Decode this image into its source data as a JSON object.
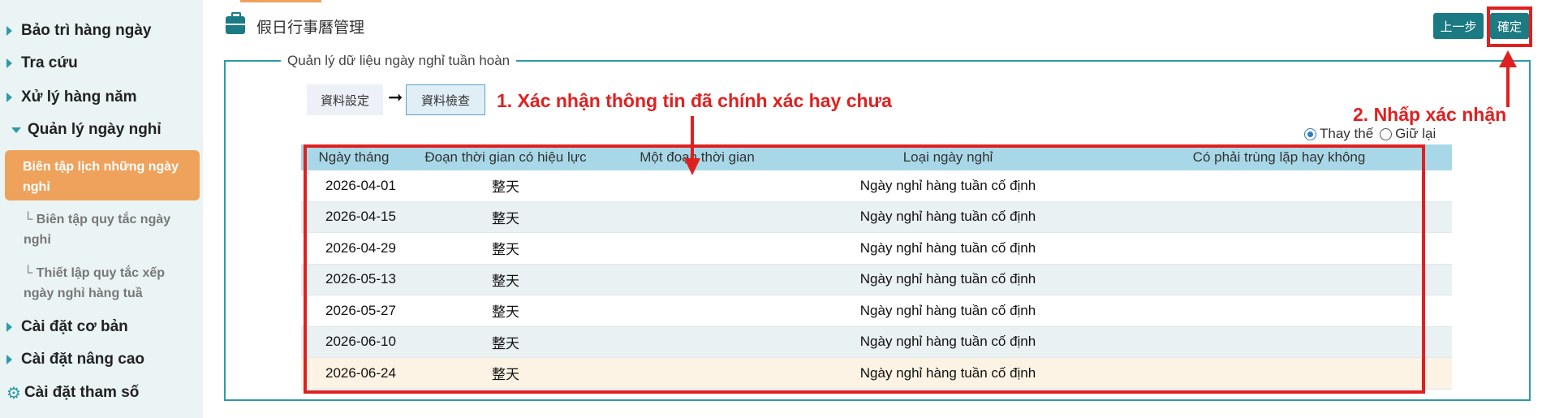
{
  "sidebar": {
    "items": [
      {
        "label": "Bảo trì hàng ngày"
      },
      {
        "label": "Tra cứu"
      },
      {
        "label": "Xử lý hàng năm"
      },
      {
        "label": "Quản lý ngày nghỉ"
      }
    ],
    "active_item": {
      "label": "Biên tập lịch những ngày nghỉ"
    },
    "sub_items": [
      {
        "label": "└ Biên tập quy tắc ngày nghỉ"
      },
      {
        "label": "└ Thiết lập quy tắc xếp ngày nghỉ hàng tuầ"
      }
    ],
    "bottom_items": [
      {
        "label": "Cài đặt cơ bản"
      },
      {
        "label": "Cài đặt nâng cao"
      },
      {
        "label": "Cài đặt tham số"
      }
    ]
  },
  "header": {
    "title": "假日行事曆管理",
    "prev_button": "上一步",
    "confirm_button": "確定"
  },
  "section": {
    "legend": "Quản lý dữ liệu ngày nghỉ tuần hoàn",
    "steps": [
      "資料設定",
      "資料檢查"
    ],
    "radio_options": [
      {
        "label": "Thay thế",
        "checked": true
      },
      {
        "label": "Giữ lại",
        "checked": false
      }
    ]
  },
  "table": {
    "headers": [
      "Ngày tháng",
      "Đoạn thời gian có hiệu lực",
      "Một đoạn thời gian",
      "Loại ngày nghỉ",
      "Có phải trùng lặp hay không"
    ],
    "rows": [
      [
        "2026-04-01",
        "整天",
        "",
        "Ngày nghỉ hàng tuần cố định",
        ""
      ],
      [
        "2026-04-15",
        "整天",
        "",
        "Ngày nghỉ hàng tuần cố định",
        ""
      ],
      [
        "2026-04-29",
        "整天",
        "",
        "Ngày nghỉ hàng tuần cố định",
        ""
      ],
      [
        "2026-05-13",
        "整天",
        "",
        "Ngày nghỉ hàng tuần cố định",
        ""
      ],
      [
        "2026-05-27",
        "整天",
        "",
        "Ngày nghỉ hàng tuần cố định",
        ""
      ],
      [
        "2026-06-10",
        "整天",
        "",
        "Ngày nghỉ hàng tuần cố định",
        ""
      ],
      [
        "2026-06-24",
        "整天",
        "",
        "Ngày nghỉ hàng tuần cố định",
        ""
      ]
    ]
  },
  "annotations": {
    "step1": "1. Xác nhận thông tin đã chính xác hay chưa",
    "step2": "2. Nhấp xác nhận",
    "color": "#e02020"
  },
  "colors": {
    "accent": "#1b7a83",
    "active_nav": "#eea25c",
    "table_header": "#a8d8e8"
  },
  "icons": {
    "nav_caret": "caret-right-icon",
    "nav_caret_open": "caret-down-icon",
    "settings": "gear-icon",
    "page": "briefcase-icon",
    "step_arrow": "arrow-right-icon"
  }
}
